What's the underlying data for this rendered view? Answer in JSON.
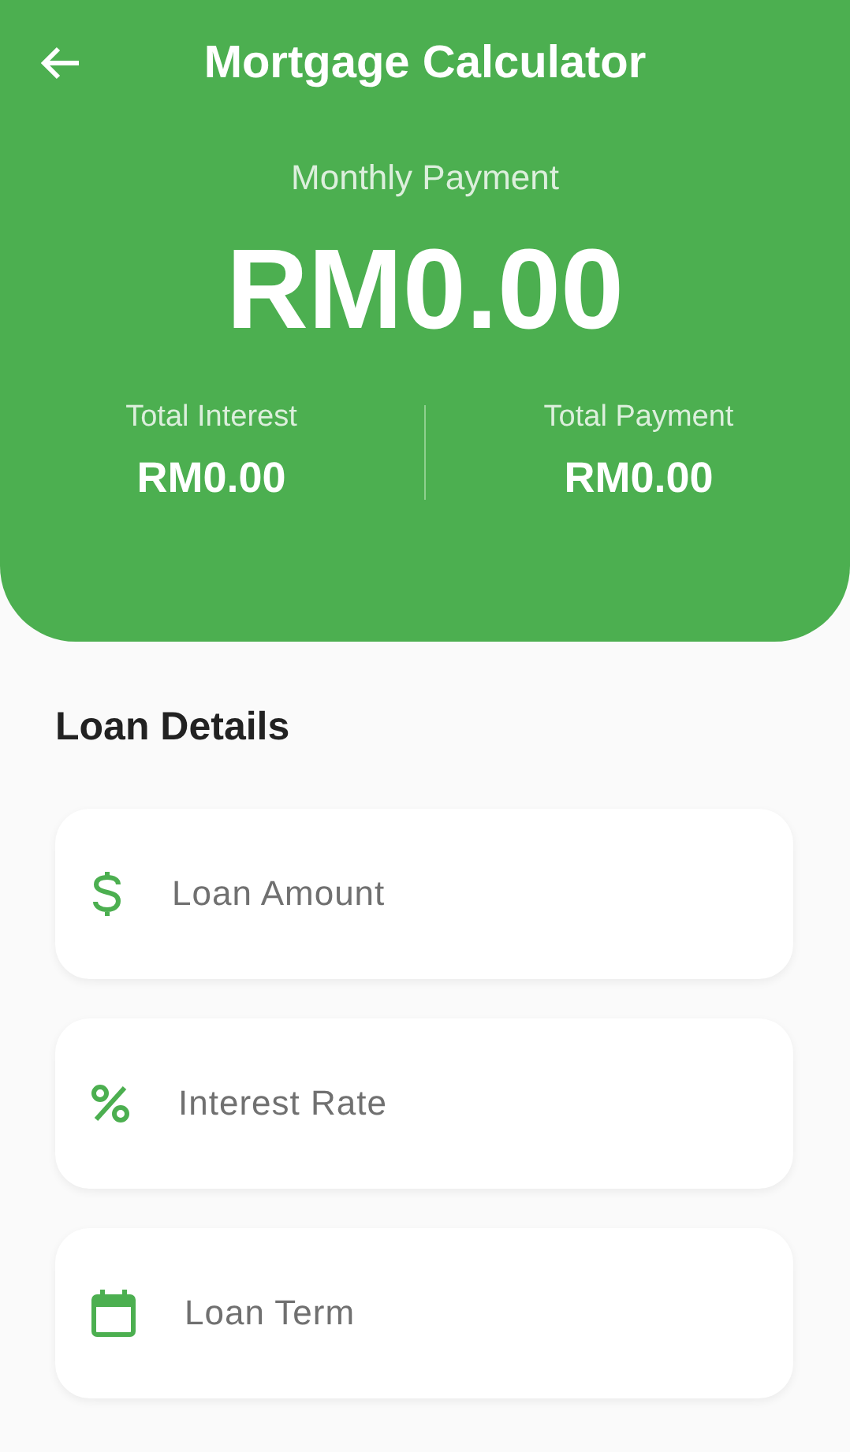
{
  "header": {
    "title": "Mortgage Calculator",
    "monthly_label": "Monthly Payment",
    "monthly_value": "RM0.00",
    "totals": [
      {
        "label": "Total Interest",
        "value": "RM0.00"
      },
      {
        "label": "Total Payment",
        "value": "RM0.00"
      }
    ]
  },
  "section_title": "Loan Details",
  "fields": [
    {
      "kind": "amount",
      "placeholder": "Loan Amount"
    },
    {
      "kind": "rate",
      "placeholder": "Interest Rate"
    },
    {
      "kind": "term",
      "placeholder": "Loan Term"
    }
  ]
}
